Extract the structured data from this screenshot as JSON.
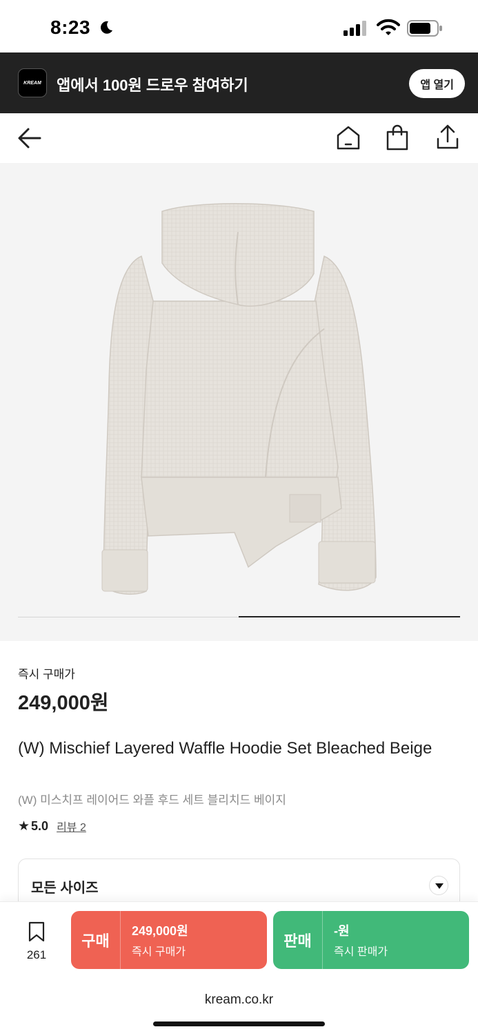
{
  "status_bar": {
    "time": "8:23"
  },
  "banner": {
    "logo_text": "KREAM",
    "text": "앱에서 100원 드로우 참여하기",
    "open_app": "앱 열기"
  },
  "nav": {
    "icons": [
      "back-arrow-icon",
      "home-icon",
      "shopping-bag-icon",
      "share-icon"
    ]
  },
  "carousel": {
    "active_index": 2,
    "total": 2
  },
  "product": {
    "price_label": "즉시 구매가",
    "price": "249,000원",
    "name": "(W) Mischief Layered Waffle Hoodie Set Bleached Beige",
    "name_ko": "(W) 미스치프 레이어드 와플 후드 세트 블리치드 베이지",
    "rating": "5.0",
    "review": "리뷰 2",
    "size_select": "모든 사이즈"
  },
  "actions": {
    "wishlist_count": "261",
    "buy": {
      "title": "구매",
      "amount": "249,000원",
      "desc": "즉시 구매가"
    },
    "sell": {
      "title": "판매",
      "amount": "-원",
      "desc": "즉시 판매가"
    }
  },
  "browser": {
    "url": "kream.co.kr"
  },
  "colors": {
    "buy": "#ef6253",
    "sell": "#41b979",
    "banner": "#222222"
  }
}
